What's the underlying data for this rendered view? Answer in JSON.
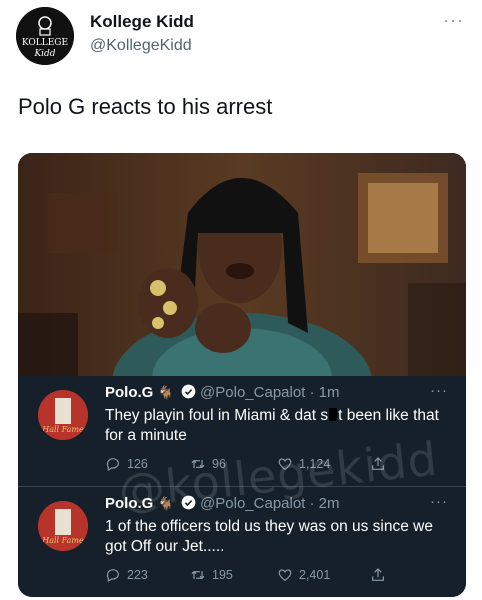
{
  "author": {
    "name": "Kollege Kidd",
    "handle": "@KollegeKidd",
    "avatar_text": "KOLLEGE Kidd"
  },
  "tweet": {
    "text": "Polo G reacts to his arrest",
    "more_icon": "more-horizontal-icon"
  },
  "watermark": "@kollegekidd",
  "embeds": [
    {
      "name": "Polo.G",
      "emoji": "🐐",
      "handle": "@Polo_Capalot",
      "time": "· 1m",
      "text_before": "They playin foul in Miami & dat s",
      "text_after": "t been like that for a minute",
      "replies": "126",
      "retweets": "96",
      "likes": "1,124"
    },
    {
      "name": "Polo.G",
      "emoji": "🐐",
      "handle": "@Polo_Capalot",
      "time": "· 2m",
      "text": "1 of the officers told us they was on us since we got Off our Jet.....",
      "replies": "223",
      "retweets": "195",
      "likes": "2,401"
    }
  ],
  "colors": {
    "embed_bg": "#15202b",
    "muted": "#8899a6",
    "verified": "#1d9bf0"
  }
}
